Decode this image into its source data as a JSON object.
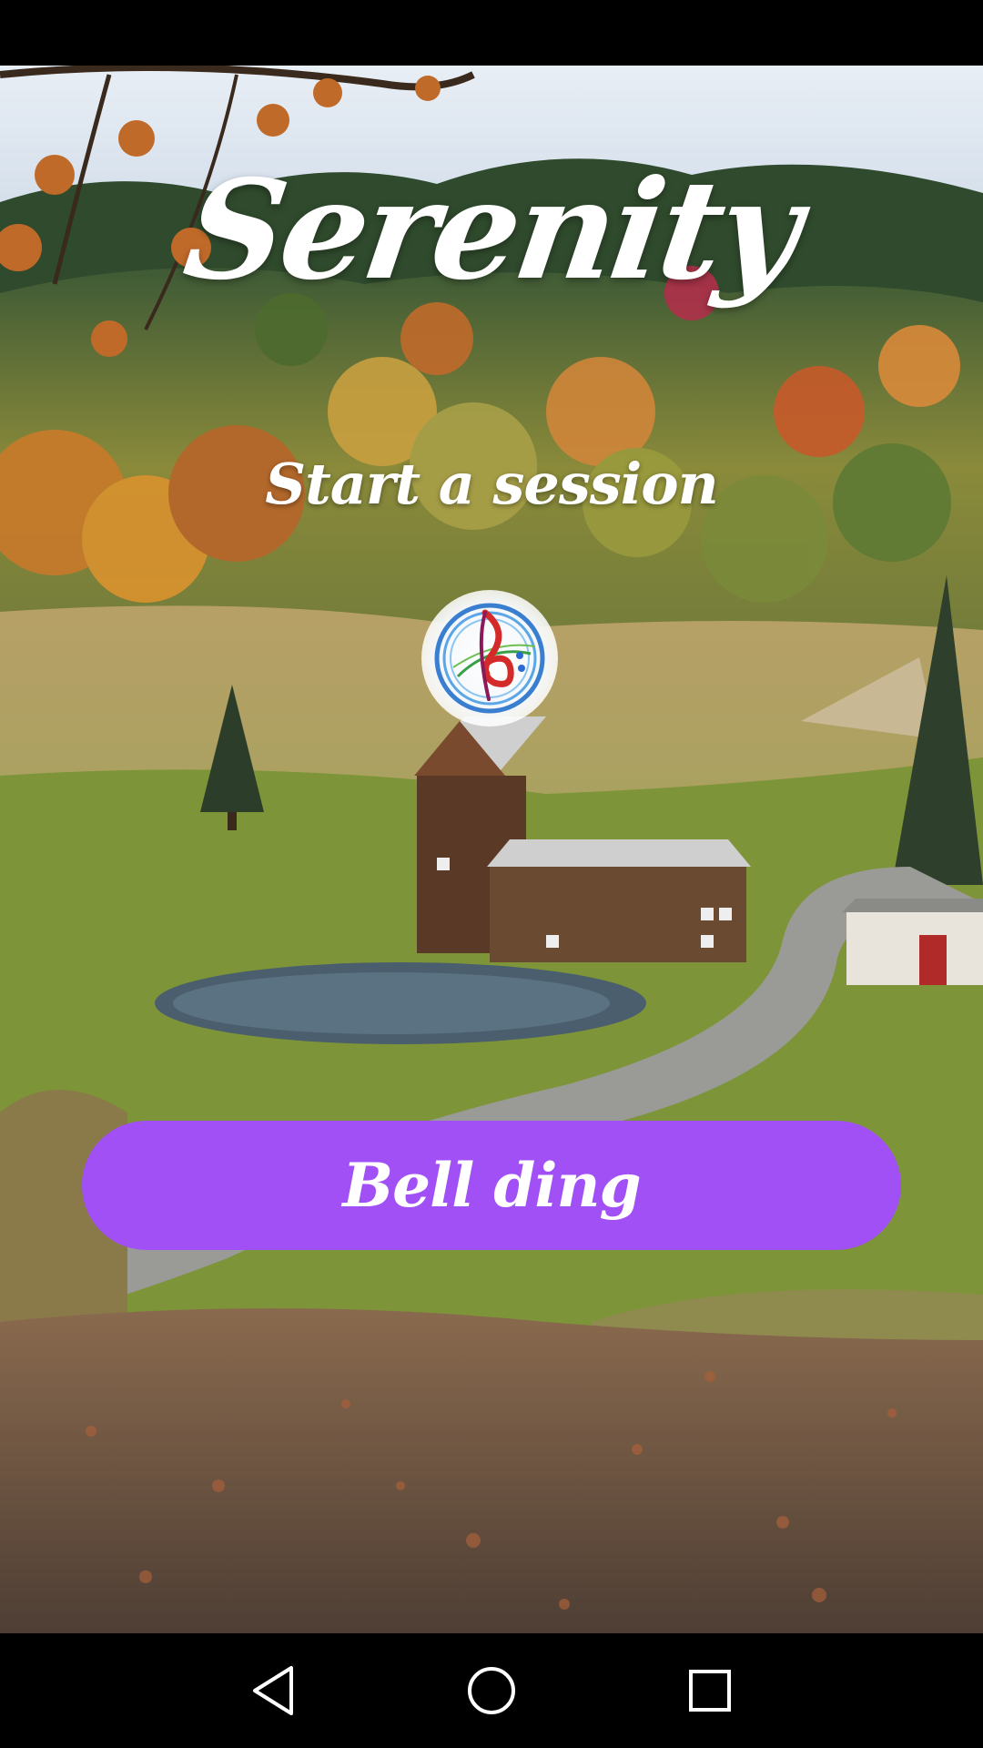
{
  "app": {
    "title": "Serenity",
    "subtitle": "Start a session"
  },
  "logo": {
    "icon": "music-clef-icon"
  },
  "main_button": {
    "label": "Bell ding",
    "color": "#a050f5"
  },
  "nav": {
    "back_icon": "back-triangle-icon",
    "home_icon": "home-circle-icon",
    "recents_icon": "recents-square-icon"
  }
}
